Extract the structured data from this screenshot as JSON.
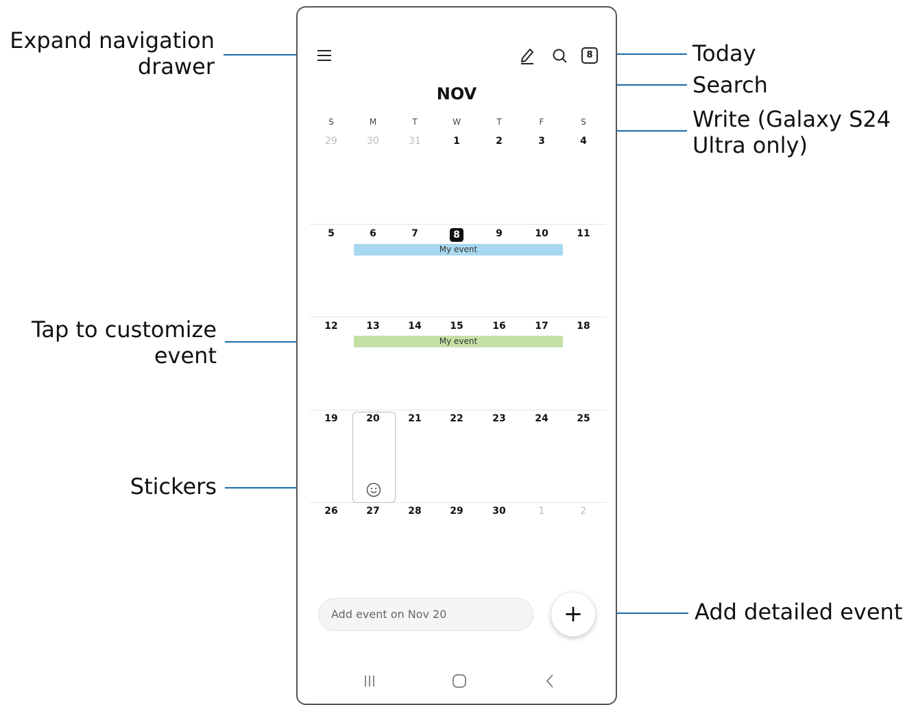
{
  "callouts": {
    "expand_nav_line1": "Expand navigation",
    "expand_nav_line2": "drawer",
    "today": "Today",
    "search": "Search",
    "write_line1": "Write (Galaxy S24",
    "write_line2": "Ultra only)",
    "tap_customize_line1": "Tap to customize",
    "tap_customize_line2": "event",
    "stickers": "Stickers",
    "add_detailed": "Add detailed event"
  },
  "header": {
    "menu_icon": "hamburger-menu-icon",
    "write_icon": "pen-icon",
    "search_icon": "search-icon",
    "today_badge": "8"
  },
  "calendar": {
    "month": "NOV",
    "weekdays": [
      "S",
      "M",
      "T",
      "W",
      "T",
      "F",
      "S"
    ],
    "weeks": [
      [
        "29",
        "30",
        "31",
        "1",
        "2",
        "3",
        "4"
      ],
      [
        "5",
        "6",
        "7",
        "8",
        "9",
        "10",
        "11"
      ],
      [
        "12",
        "13",
        "14",
        "15",
        "16",
        "17",
        "18"
      ],
      [
        "19",
        "20",
        "21",
        "22",
        "23",
        "24",
        "25"
      ],
      [
        "26",
        "27",
        "28",
        "29",
        "30",
        "1",
        "2"
      ]
    ],
    "today": "8",
    "events": [
      {
        "label": "My event",
        "color": "#a8d8f0"
      },
      {
        "label": "My event",
        "color": "#c5e0a5"
      }
    ],
    "sticker_icon": "smiley-sticker-icon"
  },
  "bottom": {
    "add_event_placeholder": "Add event on Nov 20",
    "fab_label": "+"
  },
  "navbar": {
    "recents_icon": "recents-icon",
    "home_icon": "home-icon",
    "back_icon": "back-icon"
  }
}
